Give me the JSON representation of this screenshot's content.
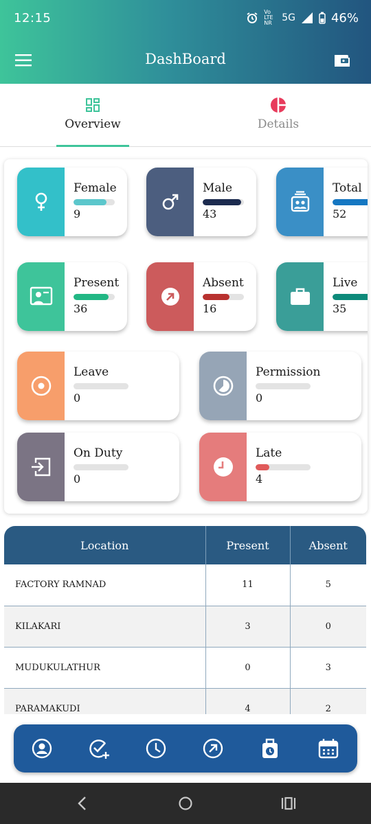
{
  "status": {
    "time": "12:15",
    "network": "5G",
    "battery": "46%"
  },
  "appbar": {
    "title": "DashBoard"
  },
  "tabs": [
    {
      "label": "Overview"
    },
    {
      "label": "Details"
    }
  ],
  "cards": [
    {
      "name": "Female",
      "value": "9",
      "fill": 0.8,
      "side": "#33c0c9",
      "bar": "#5cc7cc"
    },
    {
      "name": "Male",
      "value": "43",
      "fill": 0.93,
      "side": "#4c5e7f",
      "bar": "#1c2b4f"
    },
    {
      "name": "Total",
      "value": "52",
      "fill": 1.0,
      "side": "#3a8fc6",
      "bar": "#1577c2"
    },
    {
      "name": "Present",
      "value": "36",
      "fill": 0.85,
      "side": "#3ec49a",
      "bar": "#22b784"
    },
    {
      "name": "Absent",
      "value": "16",
      "fill": 0.65,
      "side": "#cc5b5c",
      "bar": "#b8312f"
    },
    {
      "name": "Live",
      "value": "35",
      "fill": 1.0,
      "side": "#3a9e98",
      "bar": "#0d8a7a"
    },
    {
      "name": "Leave",
      "value": "0",
      "fill": 0,
      "side": "#f79e6b",
      "bar": "#f79e6b"
    },
    {
      "name": "Permission",
      "value": "0",
      "fill": 0,
      "side": "#96a5b6",
      "bar": "#96a5b6"
    },
    {
      "name": "On Duty",
      "value": "0",
      "fill": 0,
      "side": "#7b7484",
      "bar": "#7b7484"
    },
    {
      "name": "Late",
      "value": "4",
      "fill": 0.25,
      "side": "#e57c7c",
      "bar": "#e05a5a"
    }
  ],
  "table": {
    "headers": [
      "Location",
      "Present",
      "Absent"
    ],
    "rows": [
      [
        "FACTORY RAMNAD",
        "11",
        "5"
      ],
      [
        "KILAKARI",
        "3",
        "0"
      ],
      [
        "MUDUKULATHUR",
        "0",
        "3"
      ],
      [
        "PARAMAKUDI",
        "4",
        "2"
      ]
    ]
  }
}
